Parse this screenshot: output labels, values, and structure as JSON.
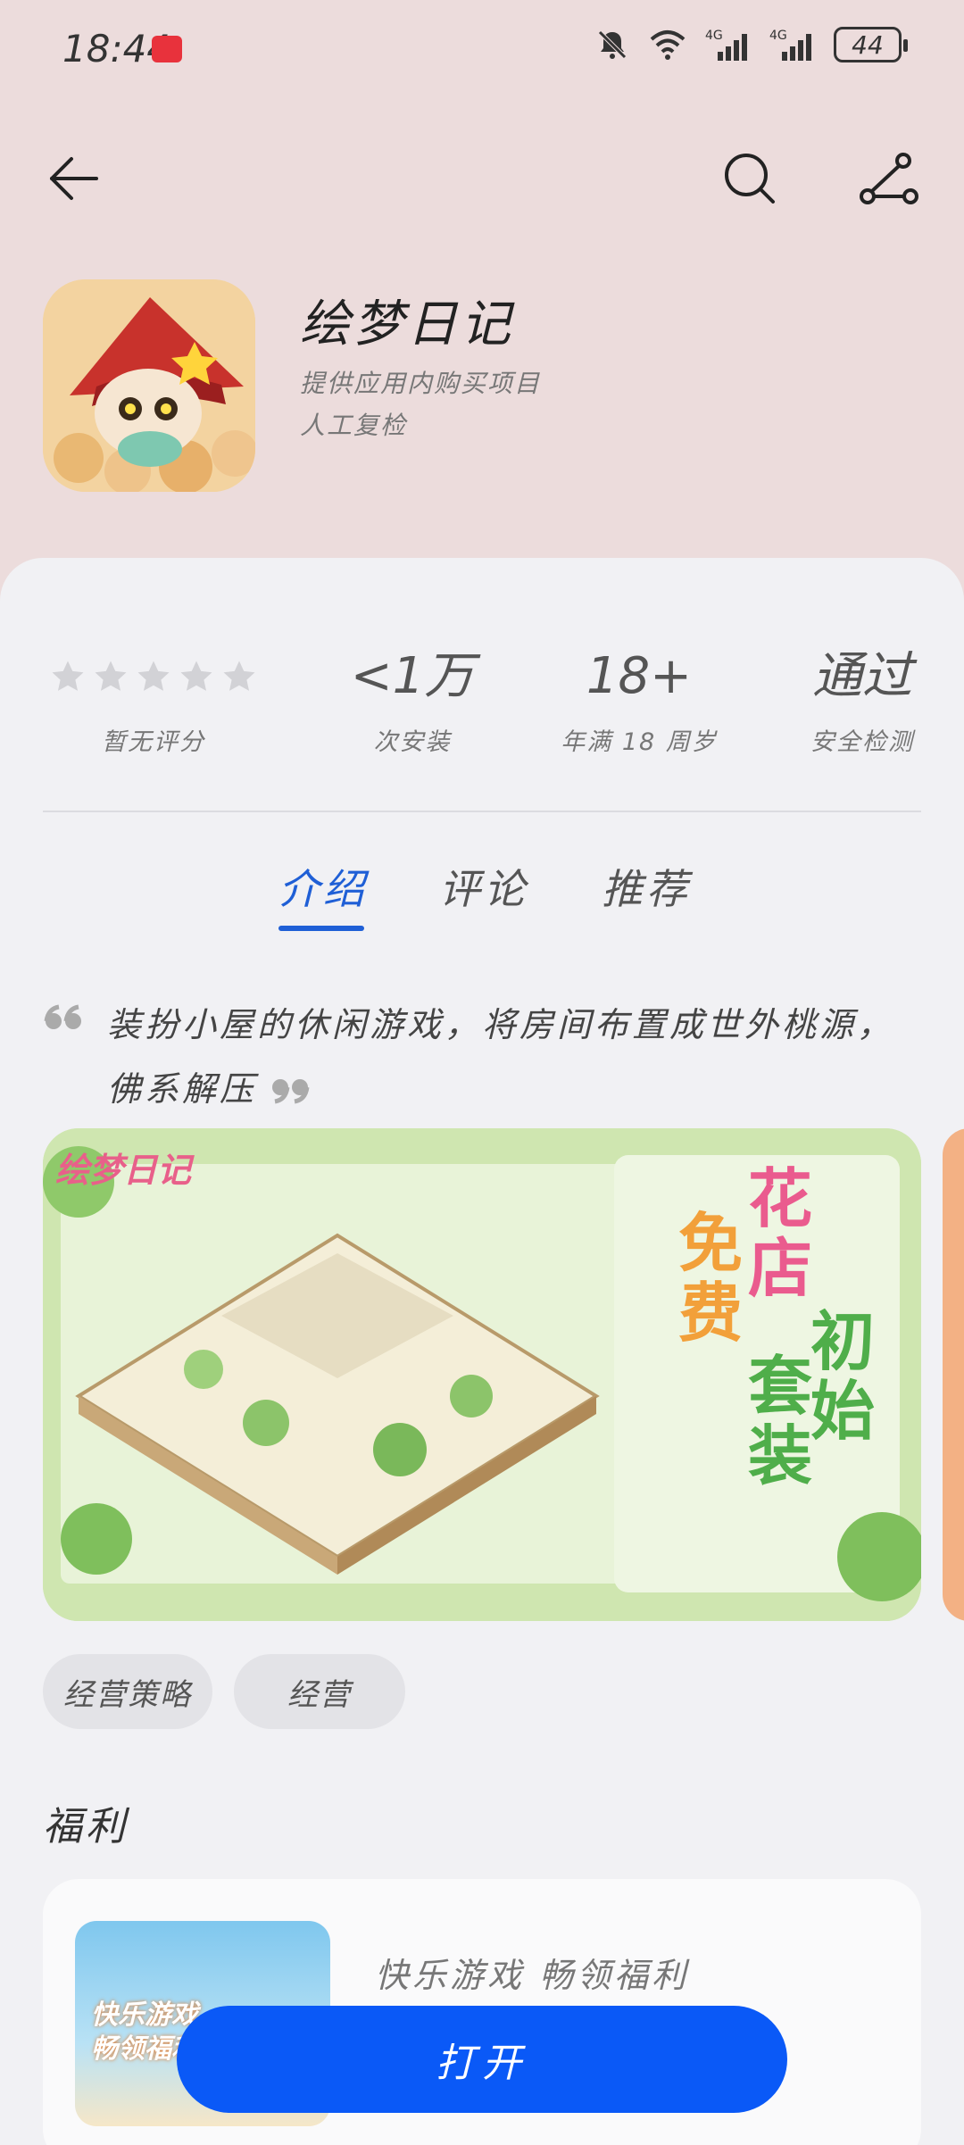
{
  "status_bar": {
    "time": "18:44",
    "battery": "44"
  },
  "app": {
    "name": "绘梦日记",
    "subtitle_1": "提供应用内购买项目",
    "subtitle_2": "人工复检"
  },
  "stats": [
    {
      "big": "",
      "small": "暂无评分",
      "stars": 5
    },
    {
      "big": "<1万",
      "small": "次安装"
    },
    {
      "big": "18+",
      "small": "年满 18 周岁"
    },
    {
      "big": "通过",
      "small": "安全检测"
    }
  ],
  "tabs": [
    {
      "label": "介绍",
      "active": true
    },
    {
      "label": "评论",
      "active": false
    },
    {
      "label": "推荐",
      "active": false
    }
  ],
  "description": "装扮小屋的休闲游戏，将房间布置成世外桃源，佛系解压",
  "screenshot": {
    "logo_text": "绘梦日记",
    "promo_text_1": "花店",
    "promo_text_2": "初始",
    "promo_text_3": "免费",
    "promo_text_4": "套装"
  },
  "tags": [
    "经营策略",
    "经营"
  ],
  "welfare": {
    "section_title": "福利",
    "title": "快乐游戏 畅领福利",
    "image_text_1": "快乐游戏",
    "image_text_2": "畅领福利"
  },
  "open_button": "打开",
  "colors": {
    "accent": "#1f5fd6",
    "button": "#0a59f7",
    "header_bg": "#ecdcdc"
  }
}
